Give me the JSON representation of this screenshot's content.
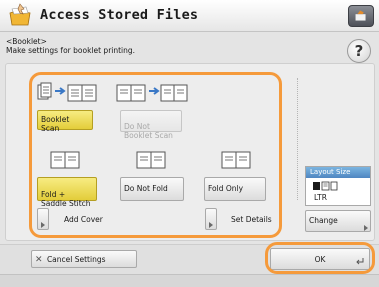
{
  "title": "Access Stored Files",
  "breadcrumb": "<Booklet>",
  "instruction": "Make settings for booklet printing.",
  "help_label": "?",
  "booklet_scan_label": "Booklet Scan",
  "do_not_booklet_scan_label": "Do Not\nBooklet Scan",
  "fold_saddle_stitch_label": "Fold +\nSaddle Stitch",
  "do_not_fold_label": "Do Not Fold",
  "fold_only_label": "Fold Only",
  "add_cover_label": "Add Cover",
  "set_details_label": "Set Details",
  "layout_size_label": "Layout Size",
  "layout_size_value": "LTR",
  "change_label": "Change",
  "cancel_settings_label": "Cancel Settings",
  "ok_label": "OK",
  "colors": {
    "highlight": "#f59a3b",
    "selected": "#e9d54d",
    "header_blue": "#4f86c1"
  }
}
